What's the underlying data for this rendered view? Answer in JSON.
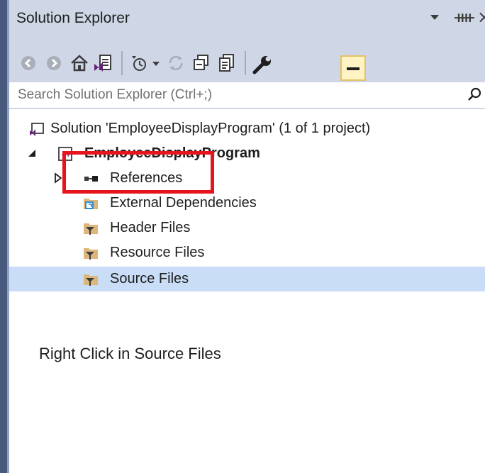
{
  "window": {
    "title": "Solution Explorer",
    "pin_glyph": "ᚓ",
    "close_glyph": "×"
  },
  "toolbar": {
    "buttons": [
      {
        "name": "back-icon"
      },
      {
        "name": "forward-icon"
      },
      {
        "name": "home-icon"
      },
      {
        "name": "switch-views-icon"
      },
      {
        "name": "pending-changes-filter-icon"
      },
      {
        "name": "sync-icon"
      },
      {
        "name": "collapse-all-icon"
      },
      {
        "name": "show-all-files-icon"
      },
      {
        "name": "properties-icon"
      },
      {
        "name": "preview-selected-items-icon"
      }
    ]
  },
  "search": {
    "placeholder": "Search Solution Explorer (Ctrl+;)"
  },
  "tree": {
    "solution": "Solution 'EmployeeDisplayProgram' (1 of 1 project)",
    "project": "EmployeeDisplayProgram",
    "items": [
      {
        "label": "References",
        "icon": "references-icon",
        "expandable": true
      },
      {
        "label": "External Dependencies",
        "icon": "external-dependencies-icon",
        "expandable": false
      },
      {
        "label": "Header Files",
        "icon": "filter-folder-icon",
        "expandable": false
      },
      {
        "label": "Resource Files",
        "icon": "filter-folder-icon",
        "expandable": false
      },
      {
        "label": "Source Files",
        "icon": "filter-folder-icon",
        "expandable": false,
        "selected": true
      }
    ]
  },
  "annotation": {
    "caption": "Right Click in Source Files",
    "highlight_color": "#e8141d"
  },
  "colors": {
    "panel_chrome": "#cfd6e5",
    "selection": "#c9ddf6",
    "accent_purple": "#68217a"
  }
}
